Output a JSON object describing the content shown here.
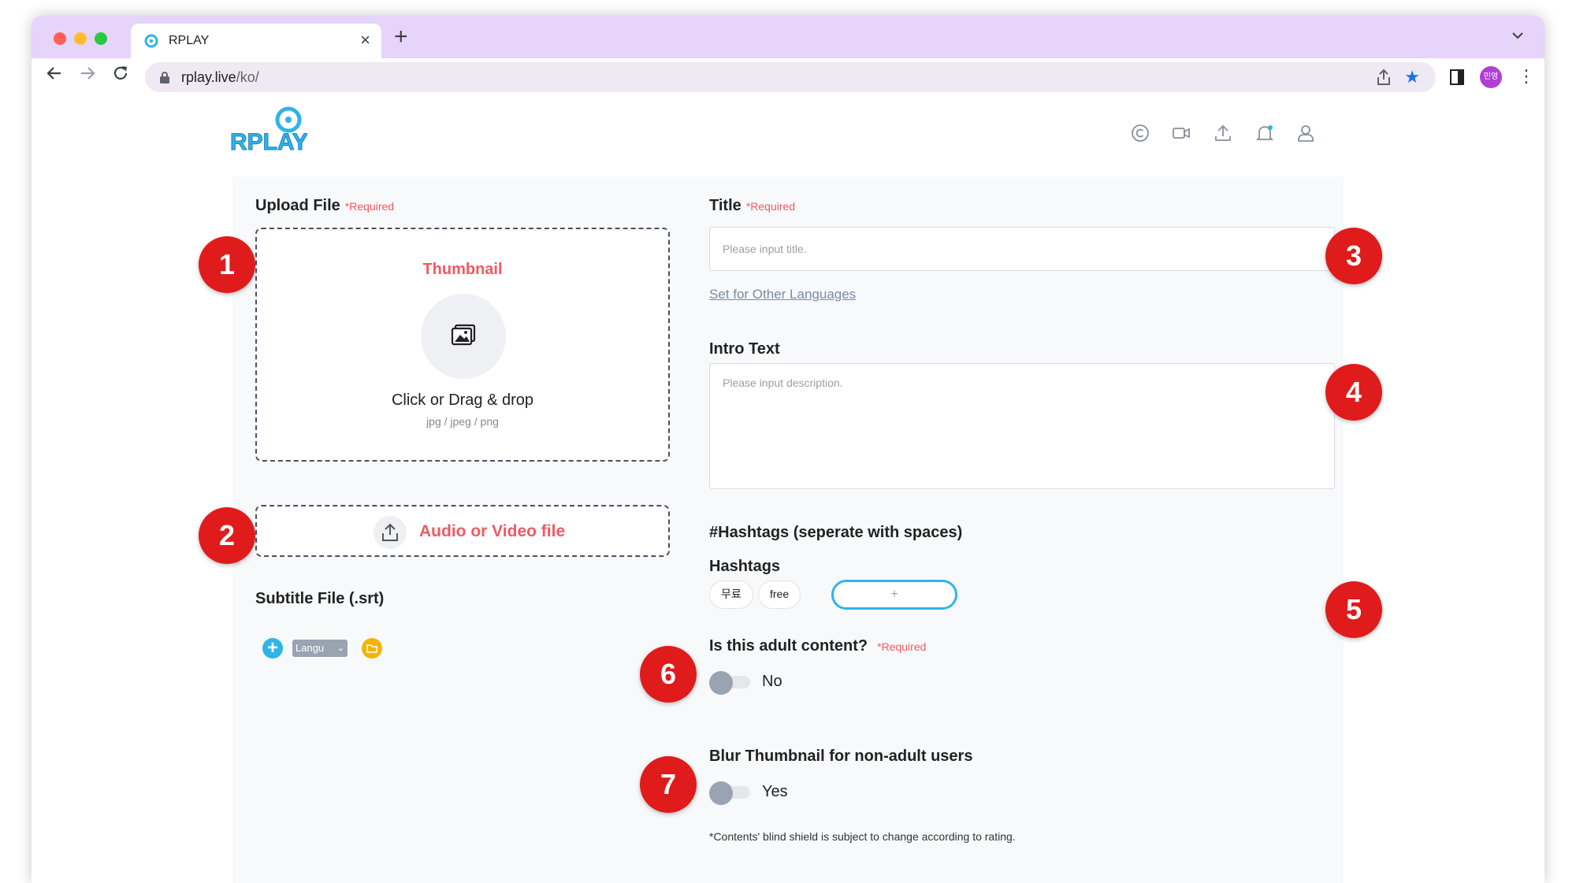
{
  "browser": {
    "tab_title": "RPLAY",
    "tab_close": "×",
    "new_tab": "+",
    "url_host": "rplay.live",
    "url_path": "/ko/",
    "profile_initials": "민영"
  },
  "site": {
    "logo_text": "RPLAY",
    "header_icons": [
      "copyright-icon",
      "video-camera-icon",
      "upload-icon",
      "bell-icon",
      "user-icon"
    ]
  },
  "form": {
    "upload_file": {
      "label": "Upload File",
      "required": "*Required",
      "thumbnail_title": "Thumbnail",
      "main_text": "Click or Drag & drop",
      "formats": "jpg / jpeg / png"
    },
    "media_file": {
      "label": "Audio or Video file"
    },
    "subtitle": {
      "label": "Subtitle File (.srt)",
      "language_select": "Langu"
    },
    "title": {
      "label": "Title",
      "required": "*Required",
      "placeholder": "Please input title.",
      "other_languages_link": "Set for Other Languages"
    },
    "intro": {
      "label": "Intro Text",
      "placeholder": "Please input description."
    },
    "hashtags": {
      "section_label": "#Hashtags (seperate with spaces)",
      "label": "Hashtags",
      "tags": [
        "무료",
        "free"
      ],
      "add_label": "+"
    },
    "adult": {
      "label": "Is this adult content?",
      "required": "*Required",
      "value": "No"
    },
    "blur": {
      "label": "Blur Thumbnail for non-adult users",
      "value": "Yes",
      "note": "*Contents' blind shield is subject to change according to rating."
    }
  },
  "callouts": [
    "1",
    "2",
    "3",
    "4",
    "5",
    "6",
    "7"
  ],
  "colors": {
    "accent_red": "#f05a62",
    "accent_blue": "#2fb4e8",
    "callout_red": "#e01b1b",
    "tab_bar": "#e6d4fa"
  }
}
